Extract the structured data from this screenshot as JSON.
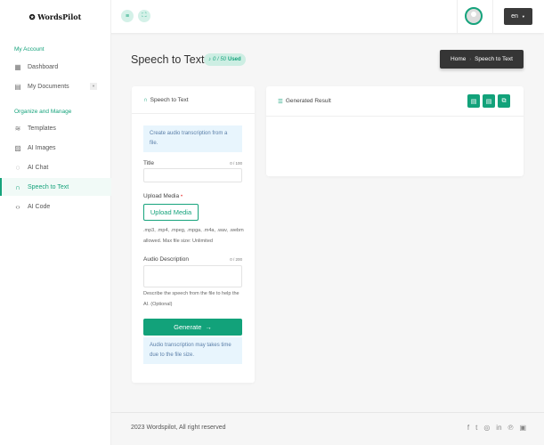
{
  "header": {
    "logo": "WordsPilot",
    "menu_icon": "≡",
    "fullscreen_icon": "⛶",
    "lang": "en"
  },
  "sidebar": {
    "section1": "My Account",
    "section2": "Organize and Manage",
    "items": [
      {
        "label": "Dashboard",
        "icon": "▦"
      },
      {
        "label": "My Documents",
        "icon": "▤"
      },
      {
        "label": "Templates",
        "icon": "≋"
      },
      {
        "label": "AI Images",
        "icon": "▨"
      },
      {
        "label": "AI Chat",
        "icon": "◌"
      },
      {
        "label": "Speech to Text",
        "icon": "∩"
      },
      {
        "label": "AI Code",
        "icon": "‹›"
      }
    ]
  },
  "page": {
    "title": "Speech to Text",
    "usage": "0 / 50",
    "usage_suffix": "Used",
    "breadcrumb_home": "Home",
    "breadcrumb_current": "Speech to Text"
  },
  "form": {
    "card_title": "Speech to Text",
    "info": "Create audio transcription from a file.",
    "title_label": "Title",
    "title_count": "0 / 100",
    "title_value": "",
    "upload_label": "Upload Media",
    "required": "•",
    "upload_button": "Upload Media",
    "formats_help": ".mp3, .mp4, .mpeg, .mpga, .m4a, .wav, .webm allowed. Max file size: Unlimited",
    "desc_label": "Audio Description",
    "desc_count": "0 / 200",
    "desc_value": "",
    "desc_help": "Describe the speech from the file to help the AI. (Optional)",
    "generate": "Generate",
    "generate_arrow": "→",
    "note": "Audio transcription may takes time due to the file size."
  },
  "result": {
    "title": "Generated Result"
  },
  "footer": {
    "copyright": "2023 Wordspilot, All right reserved",
    "social": [
      "f",
      "t",
      "◎",
      "in",
      "℗",
      "▣"
    ]
  },
  "colors": {
    "accent": "#12a27a",
    "dark": "#353535"
  }
}
